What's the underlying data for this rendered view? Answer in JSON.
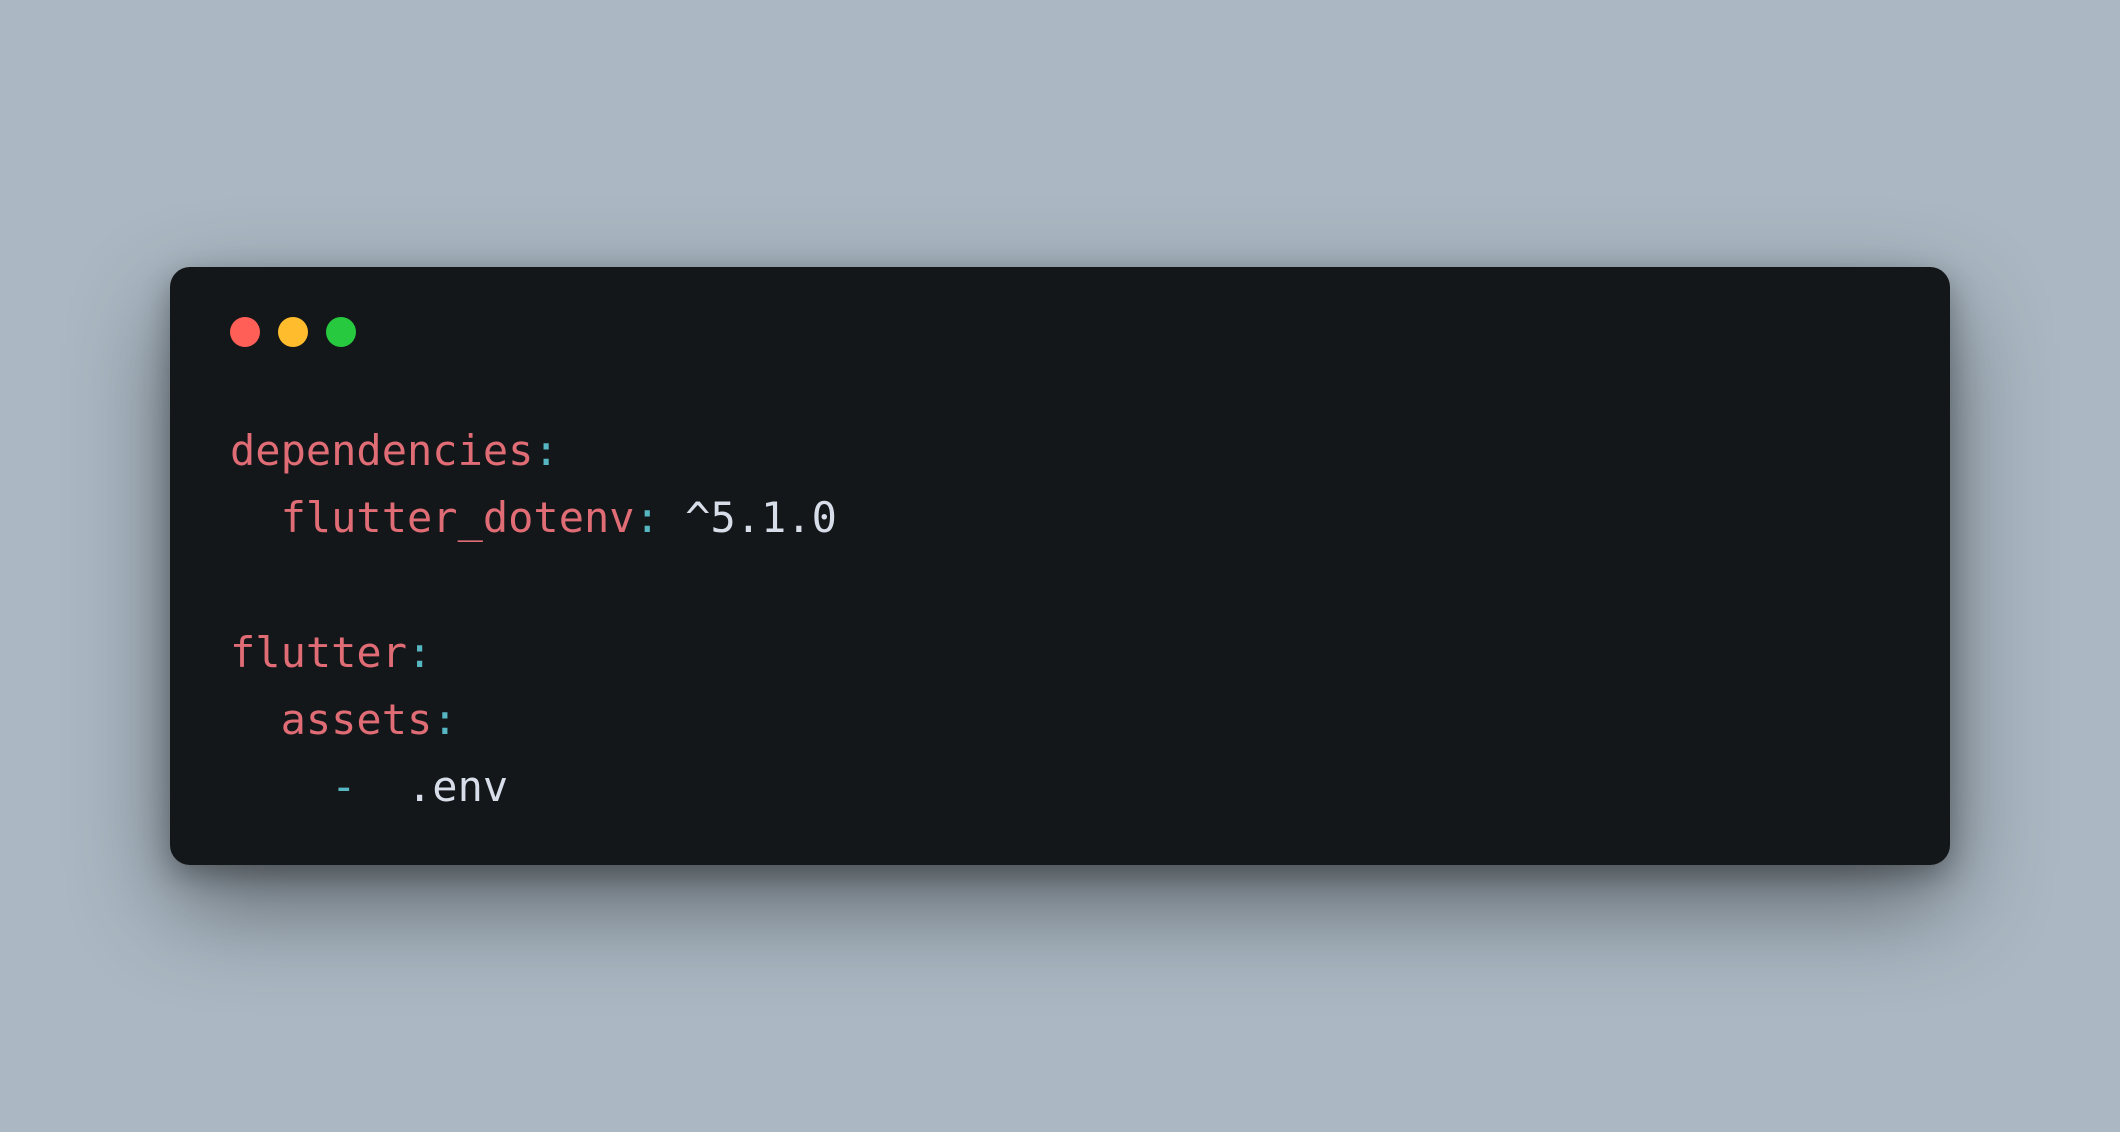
{
  "code": {
    "line1_key": "dependencies",
    "line1_colon": ":",
    "line2_key": "  flutter_dotenv",
    "line2_colon": ": ",
    "line2_value": "^5.1.0",
    "line4_key": "flutter",
    "line4_colon": ":",
    "line5_key": "  assets",
    "line5_colon": ":",
    "line6_dash": "    - ",
    "line6_value": " .env"
  },
  "colors": {
    "background": "#abb8c3",
    "window": "#141719",
    "key": "#e06c75",
    "punctuation": "#56b6c2",
    "text": "#d8dee9",
    "close": "#ff5f56",
    "minimize": "#ffbd2e",
    "maximize": "#27c93f"
  }
}
